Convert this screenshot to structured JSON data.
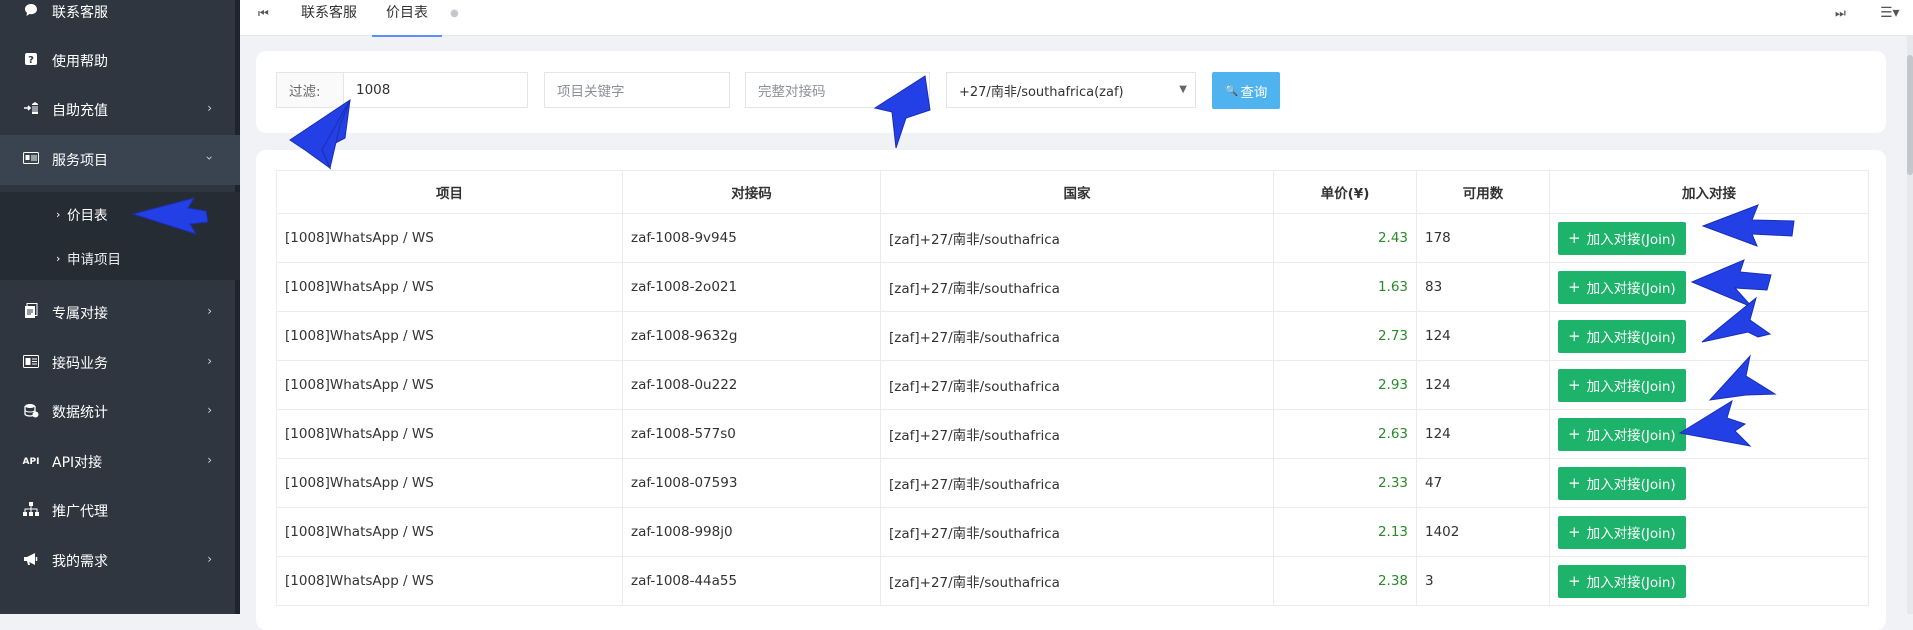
{
  "sidebar": {
    "items": [
      {
        "label": "联系客服",
        "icon": "chat-icon"
      },
      {
        "label": "使用帮助",
        "icon": "help-icon"
      },
      {
        "label": "自助充值",
        "icon": "recharge-icon"
      },
      {
        "label": "服务项目",
        "icon": "services-icon"
      },
      {
        "label": "专属对接",
        "icon": "exclusive-icon"
      },
      {
        "label": "接码业务",
        "icon": "sms-icon"
      },
      {
        "label": "数据统计",
        "icon": "database-icon"
      },
      {
        "label": "API对接",
        "icon": "api-icon"
      },
      {
        "label": "推广代理",
        "icon": "sitemap-icon"
      },
      {
        "label": "我的需求",
        "icon": "megaphone-icon"
      }
    ],
    "subitems": [
      {
        "label": "价目表"
      },
      {
        "label": "申请项目"
      }
    ],
    "api_icon_text": "API"
  },
  "topbar": {
    "tabs": [
      {
        "label": "联系客服"
      },
      {
        "label": "价目表"
      }
    ]
  },
  "filter": {
    "label": "过滤:",
    "code_value": "1008",
    "keyword_placeholder": "项目关键字",
    "full_code_placeholder": "完整对接码",
    "country_value": "+27/南非/southafrica(zaf)",
    "query_label": "查询"
  },
  "table": {
    "headers": [
      "项目",
      "对接码",
      "国家",
      "单价(¥)",
      "可用数",
      "加入对接"
    ],
    "join_label": "加入对接(Join)",
    "rows": [
      {
        "project": "[1008]WhatsApp / WS",
        "code": "zaf-1008-9v945",
        "country": "[zaf]+27/南非/southafrica",
        "price": "2.43",
        "available": "178"
      },
      {
        "project": "[1008]WhatsApp / WS",
        "code": "zaf-1008-2o021",
        "country": "[zaf]+27/南非/southafrica",
        "price": "1.63",
        "available": "83"
      },
      {
        "project": "[1008]WhatsApp / WS",
        "code": "zaf-1008-9632g",
        "country": "[zaf]+27/南非/southafrica",
        "price": "2.73",
        "available": "124"
      },
      {
        "project": "[1008]WhatsApp / WS",
        "code": "zaf-1008-0u222",
        "country": "[zaf]+27/南非/southafrica",
        "price": "2.93",
        "available": "124"
      },
      {
        "project": "[1008]WhatsApp / WS",
        "code": "zaf-1008-577s0",
        "country": "[zaf]+27/南非/southafrica",
        "price": "2.63",
        "available": "124"
      },
      {
        "project": "[1008]WhatsApp / WS",
        "code": "zaf-1008-07593",
        "country": "[zaf]+27/南非/southafrica",
        "price": "2.33",
        "available": "47"
      },
      {
        "project": "[1008]WhatsApp / WS",
        "code": "zaf-1008-998j0",
        "country": "[zaf]+27/南非/southafrica",
        "price": "2.13",
        "available": "1402"
      },
      {
        "project": "[1008]WhatsApp / WS",
        "code": "zaf-1008-44a55",
        "country": "[zaf]+27/南非/southafrica",
        "price": "2.38",
        "available": "3"
      }
    ]
  },
  "colors": {
    "sidebar_bg": "#2f3640",
    "accent_blue": "#4fb3ef",
    "join_green": "#1db36a",
    "price_green": "#2a8a2a",
    "annotation_arrow": "#2340e6"
  }
}
